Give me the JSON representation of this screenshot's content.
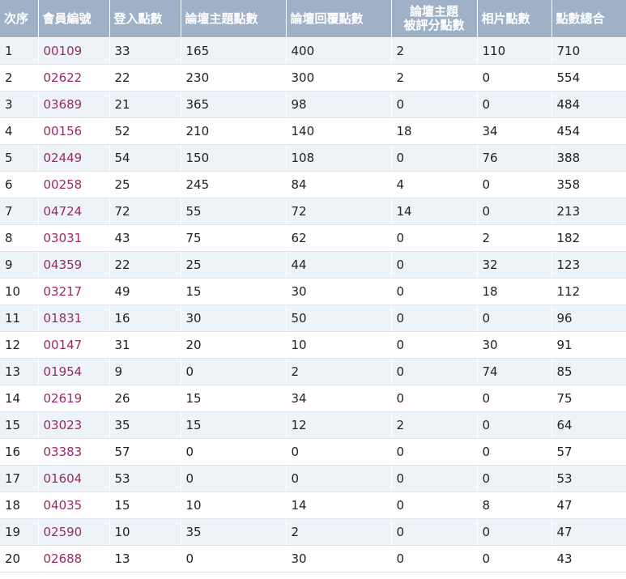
{
  "table": {
    "headers": [
      "次序",
      "會員編號",
      "登入點數",
      "論壇主題點數",
      "論壇回覆點數",
      "論壇主題",
      "被評分點數",
      "相片點數",
      "點數總合"
    ],
    "rows": [
      {
        "rank": "1",
        "member_id": "00109",
        "login": "33",
        "topic": "165",
        "reply": "400",
        "rated": "2",
        "photo": "110",
        "total": "710"
      },
      {
        "rank": "2",
        "member_id": "02622",
        "login": "22",
        "topic": "230",
        "reply": "300",
        "rated": "2",
        "photo": "0",
        "total": "554"
      },
      {
        "rank": "3",
        "member_id": "03689",
        "login": "21",
        "topic": "365",
        "reply": "98",
        "rated": "0",
        "photo": "0",
        "total": "484"
      },
      {
        "rank": "4",
        "member_id": "00156",
        "login": "52",
        "topic": "210",
        "reply": "140",
        "rated": "18",
        "photo": "34",
        "total": "454"
      },
      {
        "rank": "5",
        "member_id": "02449",
        "login": "54",
        "topic": "150",
        "reply": "108",
        "rated": "0",
        "photo": "76",
        "total": "388"
      },
      {
        "rank": "6",
        "member_id": "00258",
        "login": "25",
        "topic": "245",
        "reply": "84",
        "rated": "4",
        "photo": "0",
        "total": "358"
      },
      {
        "rank": "7",
        "member_id": "04724",
        "login": "72",
        "topic": "55",
        "reply": "72",
        "rated": "14",
        "photo": "0",
        "total": "213"
      },
      {
        "rank": "8",
        "member_id": "03031",
        "login": "43",
        "topic": "75",
        "reply": "62",
        "rated": "0",
        "photo": "2",
        "total": "182"
      },
      {
        "rank": "9",
        "member_id": "04359",
        "login": "22",
        "topic": "25",
        "reply": "44",
        "rated": "0",
        "photo": "32",
        "total": "123"
      },
      {
        "rank": "10",
        "member_id": "03217",
        "login": "49",
        "topic": "15",
        "reply": "30",
        "rated": "0",
        "photo": "18",
        "total": "112"
      },
      {
        "rank": "11",
        "member_id": "01831",
        "login": "16",
        "topic": "30",
        "reply": "50",
        "rated": "0",
        "photo": "0",
        "total": "96"
      },
      {
        "rank": "12",
        "member_id": "00147",
        "login": "31",
        "topic": "20",
        "reply": "10",
        "rated": "0",
        "photo": "30",
        "total": "91"
      },
      {
        "rank": "13",
        "member_id": "01954",
        "login": "9",
        "topic": "0",
        "reply": "2",
        "rated": "0",
        "photo": "74",
        "total": "85"
      },
      {
        "rank": "14",
        "member_id": "02619",
        "login": "26",
        "topic": "15",
        "reply": "34",
        "rated": "0",
        "photo": "0",
        "total": "75"
      },
      {
        "rank": "15",
        "member_id": "03023",
        "login": "35",
        "topic": "15",
        "reply": "12",
        "rated": "2",
        "photo": "0",
        "total": "64"
      },
      {
        "rank": "16",
        "member_id": "03383",
        "login": "57",
        "topic": "0",
        "reply": "0",
        "rated": "0",
        "photo": "0",
        "total": "57"
      },
      {
        "rank": "17",
        "member_id": "01604",
        "login": "53",
        "topic": "0",
        "reply": "0",
        "rated": "0",
        "photo": "0",
        "total": "53"
      },
      {
        "rank": "18",
        "member_id": "04035",
        "login": "15",
        "topic": "10",
        "reply": "14",
        "rated": "0",
        "photo": "8",
        "total": "47"
      },
      {
        "rank": "19",
        "member_id": "02590",
        "login": "10",
        "topic": "35",
        "reply": "2",
        "rated": "0",
        "photo": "0",
        "total": "47"
      },
      {
        "rank": "20",
        "member_id": "02688",
        "login": "13",
        "topic": "0",
        "reply": "30",
        "rated": "0",
        "photo": "0",
        "total": "43"
      }
    ]
  },
  "colors": {
    "header_bg": "#9fb1c7",
    "header_text": "#ffffff",
    "row_alt_bg": "#eef3f8",
    "member_link": "#9b2a63"
  }
}
